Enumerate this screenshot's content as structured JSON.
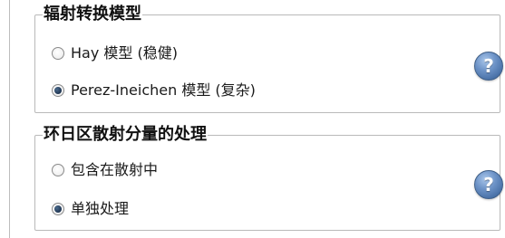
{
  "transposition_group": {
    "title": "辐射转换模型",
    "options": [
      {
        "label": "Hay 模型 (稳健)",
        "checked": false
      },
      {
        "label": "Perez-Ineichen 模型 (复杂)",
        "checked": true
      }
    ],
    "help_glyph": "?"
  },
  "circumsolar_group": {
    "title": "环日区散射分量的处理",
    "options": [
      {
        "label": "包含在散射中",
        "checked": false
      },
      {
        "label": "单独处理",
        "checked": true
      }
    ],
    "help_glyph": "?"
  },
  "icons": {
    "help": "question-mark-help-icon",
    "radio_unchecked": "radio-unchecked",
    "radio_checked": "radio-checked"
  },
  "colors": {
    "help_icon": "#5b82b8",
    "group_border": "#b9b9b9",
    "radio_dot": "#1f3552"
  }
}
